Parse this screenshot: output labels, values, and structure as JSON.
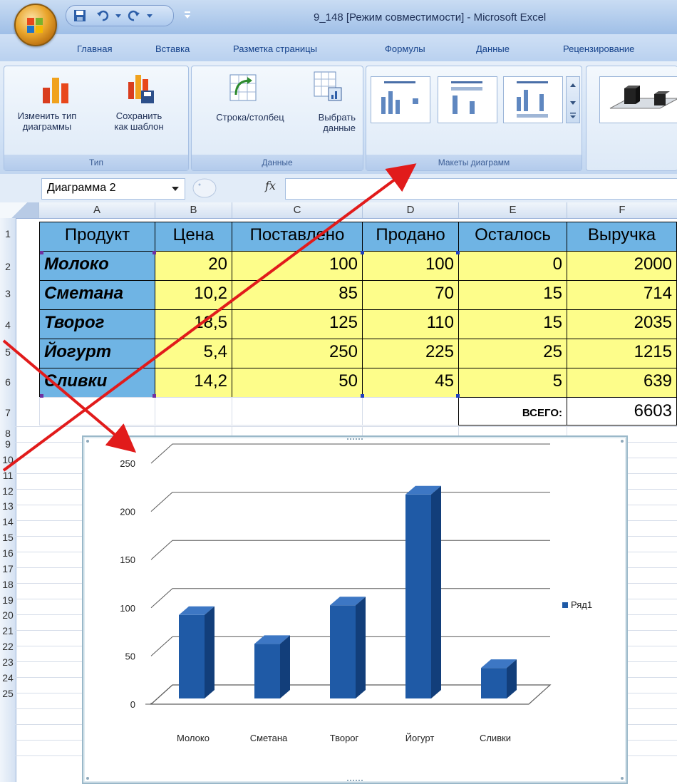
{
  "window": {
    "title": "9_148  [Режим совместимости] - Microsoft Excel"
  },
  "tabs": [
    "Главная",
    "Вставка",
    "Разметка страницы",
    "Формулы",
    "Данные",
    "Рецензирование"
  ],
  "ribbon": {
    "groups": {
      "type": {
        "label": "Тип",
        "change_type": [
          "Изменить тип",
          "диаграммы"
        ],
        "save_template": [
          "Сохранить",
          "как шаблон"
        ]
      },
      "data": {
        "label": "Данные",
        "row_col": "Строка/столбец",
        "select_data": [
          "Выбрать",
          "данные"
        ]
      },
      "layouts": {
        "label": "Макеты диаграмм"
      }
    }
  },
  "formula_bar": {
    "name_box": "Диаграмма 2",
    "fx": "fx",
    "formula": ""
  },
  "columns": [
    "A",
    "B",
    "C",
    "D",
    "E",
    "F"
  ],
  "rows": [
    "1",
    "2",
    "3",
    "4",
    "5",
    "6",
    "7",
    "8",
    "9",
    "10",
    "11",
    "12",
    "13",
    "14",
    "15",
    "16",
    "17",
    "18",
    "19",
    "20",
    "21",
    "22",
    "23",
    "24",
    "25"
  ],
  "table": {
    "headers": [
      "Продукт",
      "Цена",
      "Поставлено",
      "Продано",
      "Осталось",
      "Выручка"
    ],
    "data": [
      [
        "Молоко",
        "20",
        "100",
        "100",
        "0",
        "2000"
      ],
      [
        "Сметана",
        "10,2",
        "85",
        "70",
        "15",
        "714"
      ],
      [
        "Творог",
        "18,5",
        "125",
        "110",
        "15",
        "2035"
      ],
      [
        "Йогурт",
        "5,4",
        "250",
        "225",
        "25",
        "1215"
      ],
      [
        "Сливки",
        "14,2",
        "50",
        "45",
        "5",
        "639"
      ]
    ],
    "total_label": "ВСЕГО:",
    "total_value": "6603"
  },
  "chart_data": {
    "type": "bar",
    "style": "3d-column",
    "categories": [
      "Молоко",
      "Сметана",
      "Творог",
      "Йогурт",
      "Сливки"
    ],
    "series": [
      {
        "name": "Ряд1",
        "values": [
          100,
          70,
          110,
          225,
          45
        ],
        "color": "#1f5aa6"
      }
    ],
    "yticks": [
      "0",
      "50",
      "100",
      "150",
      "200",
      "250"
    ],
    "ylim": [
      0,
      250
    ],
    "title": "",
    "xlabel": "",
    "ylabel": "",
    "grid": true,
    "legend": "right"
  },
  "colors": {
    "header_fill": "#6fb4e4",
    "value_fill": "#fdfd8a",
    "bar": "#1f5aa6",
    "arrow": "#e11b1b"
  }
}
